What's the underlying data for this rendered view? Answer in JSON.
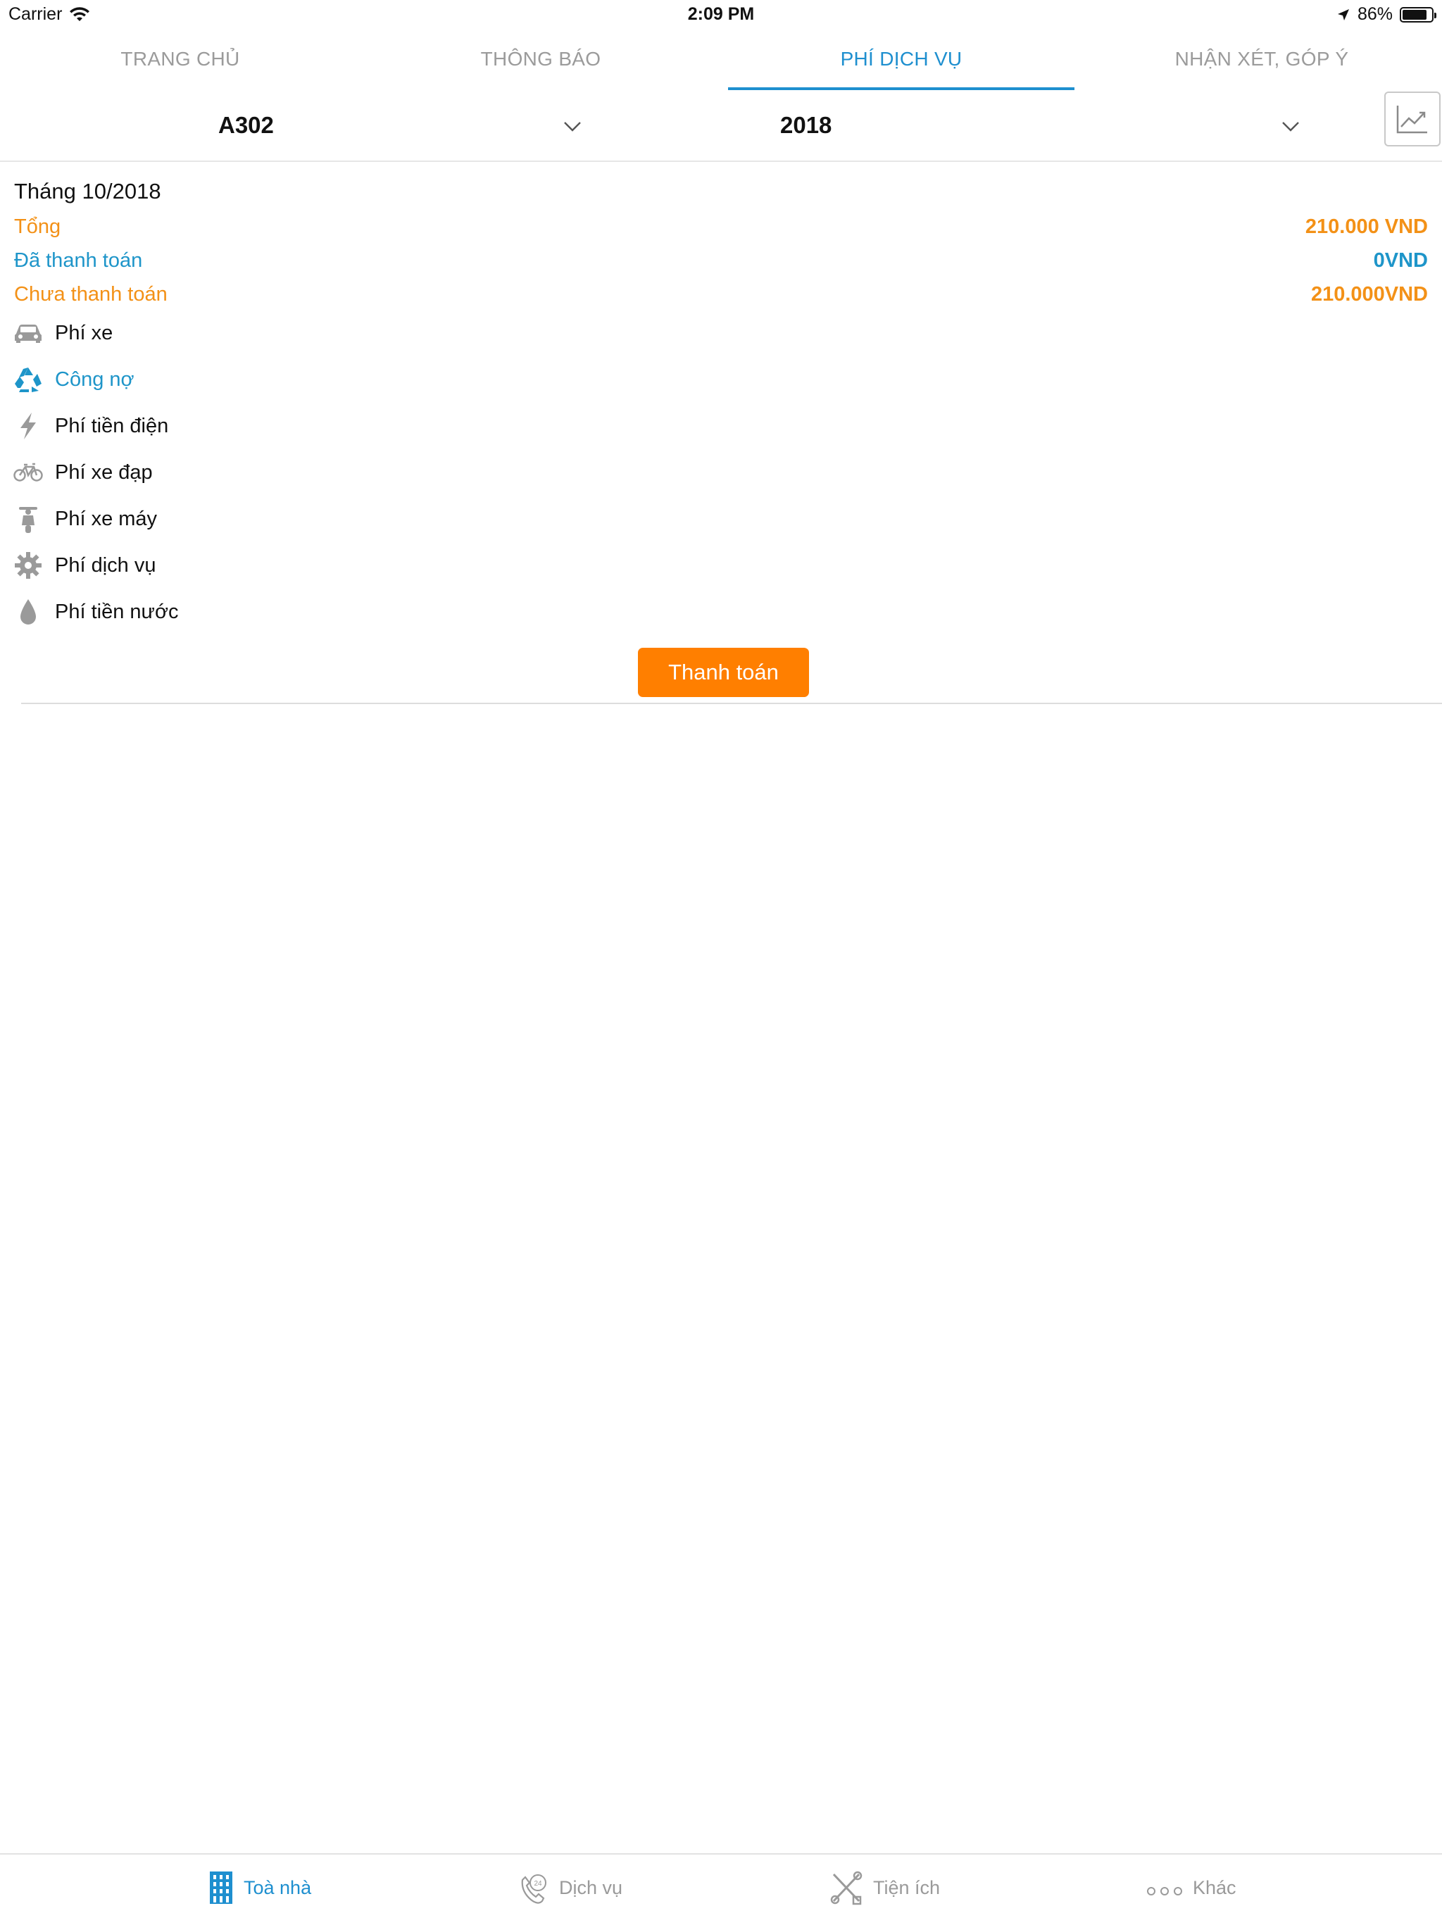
{
  "status_bar": {
    "carrier": "Carrier",
    "time": "2:09 PM",
    "battery": "86%",
    "battery_level": 0.86
  },
  "tabs": [
    {
      "label": "TRANG CHỦ",
      "active": false
    },
    {
      "label": "THÔNG BÁO",
      "active": false
    },
    {
      "label": "PHÍ DỊCH VỤ",
      "active": true
    },
    {
      "label": "NHẬN XÉT, GÓP Ý",
      "active": false
    }
  ],
  "filters": {
    "apartment": "A302",
    "year": "2018",
    "chart_icon": "trend-chart-icon"
  },
  "summary": {
    "month_title": "Tháng 10/2018",
    "total_label": "Tổng",
    "total_value": "210.000 VND",
    "paid_label": "Đã thanh toán",
    "paid_value": "0VND",
    "unpaid_label": "Chưa thanh toán",
    "unpaid_value": "210.000VND"
  },
  "fees": [
    {
      "label": "Phí xe",
      "icon": "car-icon"
    },
    {
      "label": "Công nợ",
      "icon": "recycle-icon"
    },
    {
      "label": "Phí tiền điện",
      "icon": "lightning-icon"
    },
    {
      "label": "Phí xe đạp",
      "icon": "bicycle-icon"
    },
    {
      "label": "Phí xe máy",
      "icon": "scooter-icon"
    },
    {
      "label": "Phí dịch vụ",
      "icon": "gear-icon"
    },
    {
      "label": "Phí tiền nước",
      "icon": "water-drop-icon"
    }
  ],
  "pay_button": "Thanh toán",
  "bottom_tabs": [
    {
      "label": "Toà nhà",
      "icon": "building-icon",
      "active": true
    },
    {
      "label": "Dịch vụ",
      "icon": "phone-24-icon",
      "active": false
    },
    {
      "label": "Tiện ích",
      "icon": "tools-icon",
      "active": false
    },
    {
      "label": "Khác",
      "icon": "more-dots-icon",
      "active": false
    }
  ],
  "colors": {
    "accent_blue": "#1e8fcf",
    "orange": "#f39117",
    "button_orange": "#ff7f00"
  }
}
